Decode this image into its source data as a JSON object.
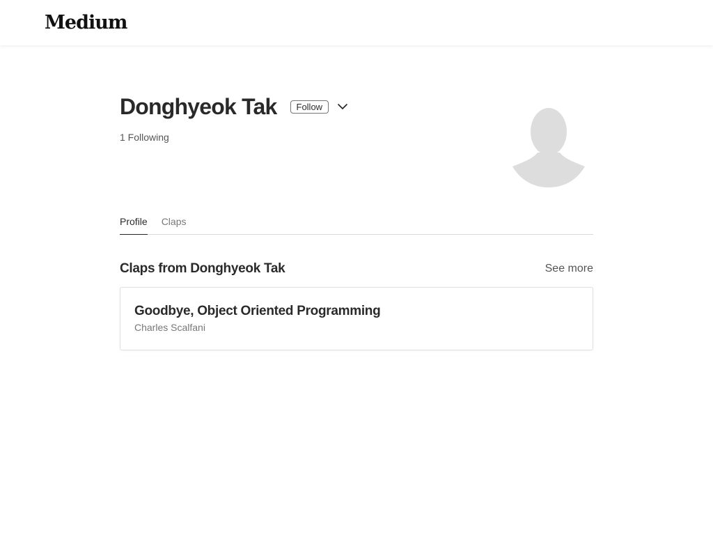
{
  "header": {
    "logo_text": "Medium"
  },
  "profile": {
    "name": "Donghyeok Tak",
    "follow_label": "Follow",
    "following_text": "1 Following"
  },
  "tabs": [
    {
      "label": "Profile",
      "active": true
    },
    {
      "label": "Claps",
      "active": false
    }
  ],
  "claps_section": {
    "title": "Claps from Donghyeok Tak",
    "see_more_label": "See more",
    "items": [
      {
        "title": "Goodbye, Object Oriented Programming",
        "author": "Charles Scalfani"
      }
    ]
  },
  "colors": {
    "avatar_placeholder": "#dddddd",
    "text_primary": "#292929"
  },
  "icons": {
    "chevron": "chevron-down-icon",
    "avatar": "default-avatar-silhouette"
  }
}
